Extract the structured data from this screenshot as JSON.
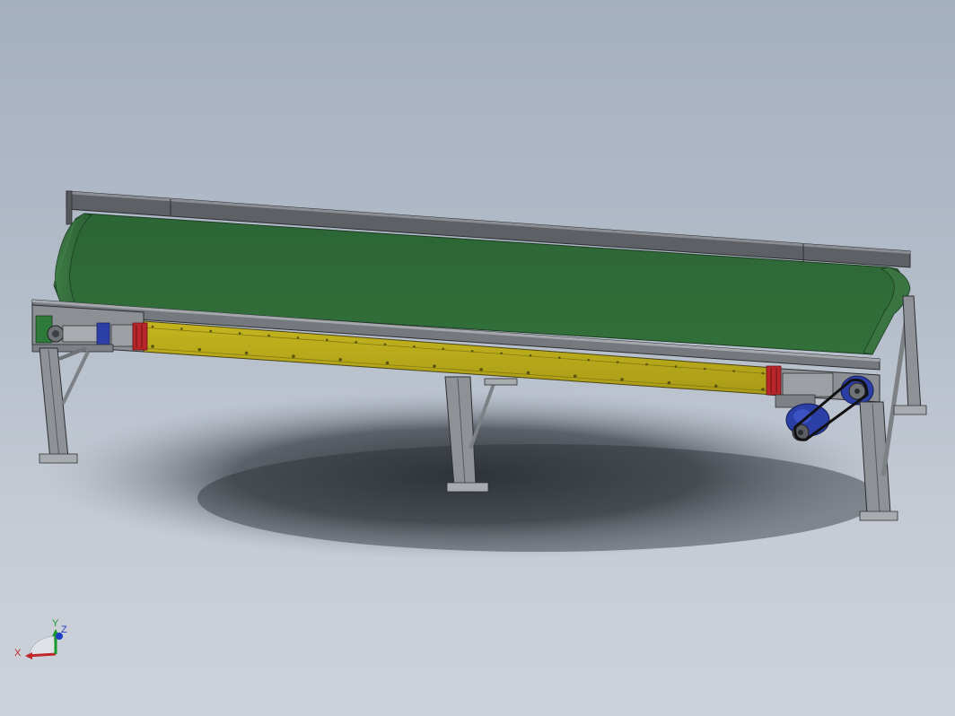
{
  "viewport": {
    "background_top": "#a5b0bf",
    "background_bottom": "#cdd2da"
  },
  "model": {
    "belt_color": "#2f6b38",
    "side_frame_color": "#b7a81a",
    "frame_color": "#6f7378",
    "motor_color": "#2c3fa6",
    "guard_color": "#b8262a"
  },
  "triad": {
    "x_label": "X",
    "y_label": "Y",
    "z_label": "Z",
    "x_color": "#c0282c",
    "y_color": "#1b9a2a",
    "z_color": "#1f3fc2"
  }
}
